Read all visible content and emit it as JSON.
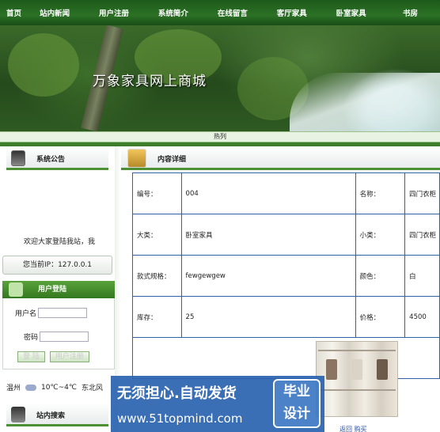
{
  "nav": {
    "items": [
      "首页",
      "站内新闻",
      "用户注册",
      "系统简介",
      "在线留言",
      "客厅家具",
      "卧室家具",
      "书房"
    ]
  },
  "banner": {
    "title": "万象家具网上商城"
  },
  "hotbar": {
    "text": "热列"
  },
  "sidebar": {
    "notice_title": "系统公告",
    "notice_text": "欢迎大家登陆我站，我",
    "ip_text": "您当前IP：127.0.0.1",
    "login_title": "用户登陆",
    "username_label": "用户名",
    "password_label": "密码",
    "login_button": "登 陆",
    "register_button": "用户注册",
    "weather": {
      "city": "温州",
      "temp": "10℃~4℃",
      "wind": "东北风"
    },
    "search_title": "站内搜索"
  },
  "content": {
    "title": "内容详细",
    "rows": [
      {
        "k1": "编号：",
        "v1": "004",
        "k2": "名称：",
        "v2": "四门衣柜"
      },
      {
        "k1": "大类：",
        "v1": "卧室家具",
        "k2": "小类：",
        "v2": "四门衣柜"
      },
      {
        "k1": "款式规格：",
        "v1": "fewgewgew",
        "k2": "颜色：",
        "v2": "白"
      },
      {
        "k1": "库存：",
        "v1": "25",
        "k2": "价格：",
        "v2": "4500"
      }
    ],
    "links": "返回   购买"
  },
  "watermark": {
    "line1": "无须担心.自动发货",
    "line2": "www.51topmind.com",
    "logo_line1": "毕业",
    "logo_line2": "设计"
  }
}
